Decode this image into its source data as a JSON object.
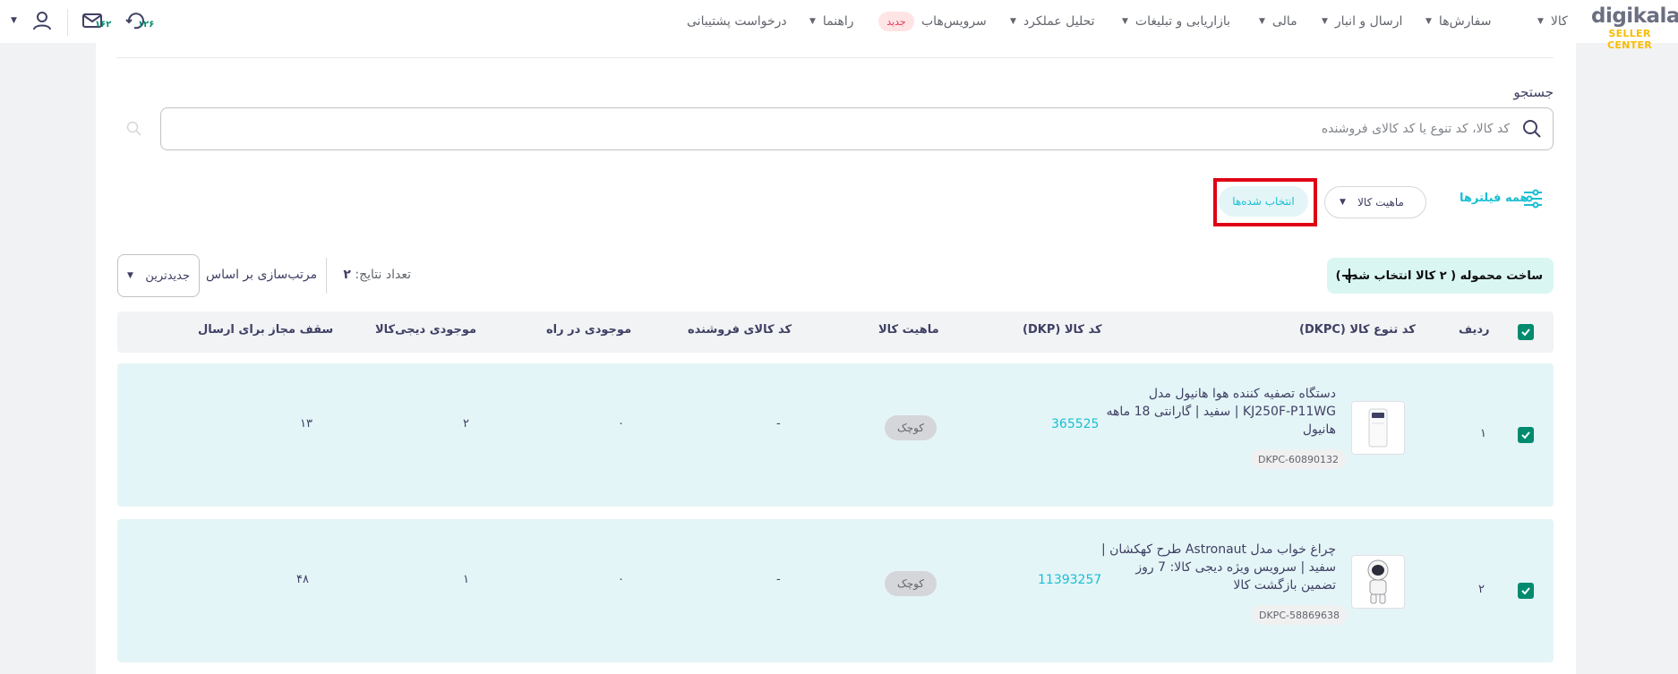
{
  "header": {
    "logo": "digikala",
    "logo_sub": "SELLER CENTER",
    "nav": [
      {
        "label": "کالا",
        "caret": true
      },
      {
        "label": "سفارش‌ها",
        "caret": true
      },
      {
        "label": "ارسال و انبار",
        "caret": true
      },
      {
        "label": "مالی",
        "caret": true
      },
      {
        "label": "بازاریابی و تبلیغات",
        "caret": true
      },
      {
        "label": "تحلیل عملکرد",
        "caret": true
      },
      {
        "label": "سرویس‌هاب",
        "caret": false
      },
      {
        "label": "راهنما",
        "caret": true
      },
      {
        "label": "درخواست پشتیبانی",
        "caret": false
      }
    ],
    "new_badge": "جدید",
    "messages_count": "۱۶۲",
    "notifications_count": "۱۲۶"
  },
  "search": {
    "label": "جستجو",
    "placeholder": "کد کالا، کد تنوع یا کد کالای فروشنده"
  },
  "filters": {
    "all_filters": "همه فیلترها",
    "nature": "ماهیت کالا",
    "selected": "انتخاب شده‌ها"
  },
  "toolbar": {
    "build_shipment": "ساخت محموله ( ۲ کالا انتخاب شده )",
    "results_label": "تعداد نتایج:",
    "results_count": "۲",
    "sort_label": "مرتب‌سازی بر اساس",
    "sort_value": "جدیدترین"
  },
  "table": {
    "headers": {
      "row": "ردیف",
      "dkpc": "کد تنوع کالا (DKPC)",
      "dkp": "کد کالا (DKP)",
      "nature": "ماهیت کالا",
      "seller_code": "کد کالای فروشنده",
      "in_transit": "موجودی در راه",
      "stock": "موجودی دیجی‌کالا",
      "cap": "سقف مجاز برای ارسال"
    },
    "rows": [
      {
        "index": "۱",
        "name": "دستگاه تصفیه کننده هوا هانیول مدل KJ250F-P11WG | سفید | گارانتی 18 ماهه هانیول",
        "dkpc": "DKPC-60890132",
        "dkp": "365525",
        "nature": "کوچک",
        "seller_code": "-",
        "in_transit": "۰",
        "stock": "۲",
        "cap": "۱۳"
      },
      {
        "index": "۲",
        "name": "چراغ خواب مدل Astronaut طرح کهکشان | سفید | سرویس ویژه دیجی کالا: 7 روز تضمین بازگشت کالا",
        "dkpc": "DKPC-58869638",
        "dkp": "11393257",
        "nature": "کوچک",
        "seller_code": "-",
        "in_transit": "۰",
        "stock": "۱",
        "cap": "۴۸"
      }
    ]
  },
  "colors": {
    "accent": "#19bfd3",
    "brand_yellow": "#f9bc00",
    "checkbox": "#008b6f",
    "row_bg": "#e4f5f7",
    "highlight": "#e00016"
  }
}
